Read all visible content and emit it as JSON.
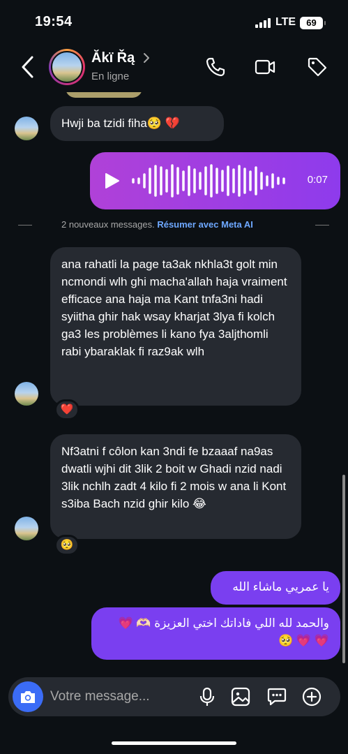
{
  "status_bar": {
    "time": "19:54",
    "network": "LTE",
    "battery": "69"
  },
  "header": {
    "name": "Ăkï Řą",
    "status": "En ligne",
    "icons": [
      "back-icon",
      "chevron-right-icon",
      "phone-icon",
      "video-icon",
      "tag-icon"
    ]
  },
  "messages": {
    "m1": "Hwji ba tzidi fiha🥺 💔",
    "voice_duration": "0:07",
    "divider_text": "2 nouveaux messages.",
    "divider_link": "Résumer avec Meta AI",
    "m2": "ana rahatli la page ta3ak nkhla3t golt min ncmondi wlh ghi macha'allah haja vraiment efficace ana haja ma Kant tnfa3ni hadi syiitha ghir hak wsay kharjat 3lya fi kolch ga3 les problèmes li kano fya 3aljthomli rabi ybaraklak fi raz9ak wlh",
    "m2_reaction": "❤️",
    "m3": "Nf3atni f côlon kan 3ndi fe bzaaaf na9as dwatli wjhi dit 3lik 2 boit w Ghadi nzid nadi 3lik nchlh zadt 4 kilo fi 2 mois w ana li Kont s3iba Bach nzid ghir kilo 😂",
    "m3_reaction": "🥺",
    "m4": "يا عمريي ماشاء الله",
    "m5": "والحمد لله اللي فاداتك اختي العزيزة 🫶🏻 💗 💗 💗 🥺"
  },
  "composer": {
    "placeholder": "Votre message...",
    "icons": [
      "camera-icon",
      "microphone-icon",
      "gallery-icon",
      "sticker-icon",
      "plus-icon"
    ]
  },
  "colors": {
    "background": "#0c1014",
    "incoming": "#262a31",
    "outgoing": "#7a3ff0",
    "accent": "#3b6cf6"
  }
}
